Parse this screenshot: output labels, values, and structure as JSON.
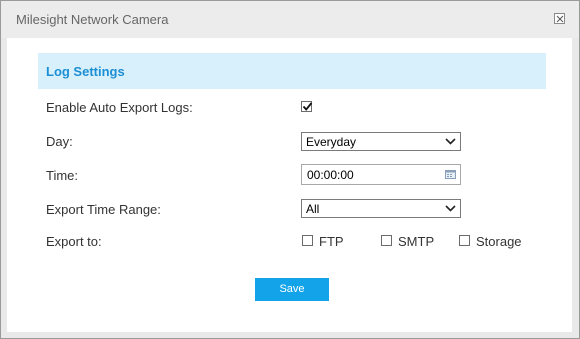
{
  "window": {
    "title": "Milesight Network Camera",
    "close_icon": "close-icon"
  },
  "section": {
    "title": "Log Settings"
  },
  "fields": {
    "enable_auto_export": {
      "label": "Enable Auto Export Logs:",
      "checked": true
    },
    "day": {
      "label": "Day:",
      "value": "Everyday"
    },
    "time": {
      "label": "Time:",
      "value": "00:00:00",
      "icon": "calendar-icon"
    },
    "export_time_range": {
      "label": "Export Time Range:",
      "value": "All"
    },
    "export_to": {
      "label": "Export to:",
      "options": [
        {
          "label": "FTP",
          "checked": false
        },
        {
          "label": "SMTP",
          "checked": false
        },
        {
          "label": "Storage",
          "checked": false
        }
      ]
    }
  },
  "actions": {
    "save_label": "Save"
  },
  "colors": {
    "accent": "#13a3e8",
    "section_bg": "#d8f0fb",
    "section_title": "#1b8fd4",
    "titlebar_bg": "#ececec"
  }
}
